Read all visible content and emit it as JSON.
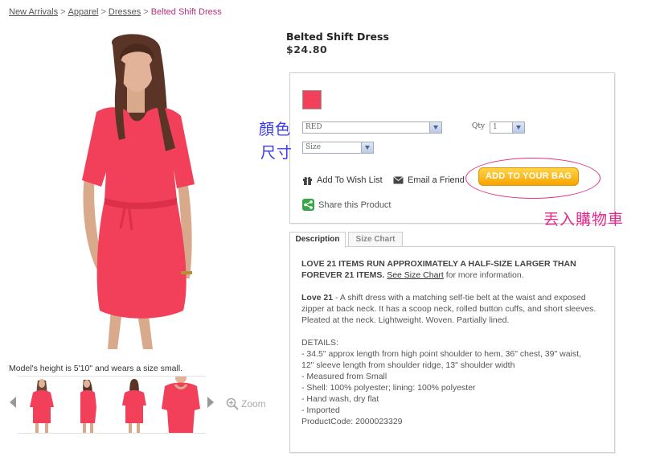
{
  "breadcrumb": {
    "items": [
      "New Arrivals",
      "Apparel",
      "Dresses"
    ],
    "separator": ">",
    "current": "Belted Shift Dress"
  },
  "product": {
    "title": "Belted Shift Dress",
    "price": "$24.80",
    "model_note": "Model's height is 5'10\" and wears a size small.",
    "dress_color": "#f2405a",
    "main_image_icon": "model-photo"
  },
  "gallery": {
    "thumbnail_count": 4,
    "zoom_label": "Zoom",
    "prev_icon": "arrow-left-icon",
    "next_icon": "arrow-right-icon"
  },
  "options": {
    "swatch_color": "#f2405a",
    "color_value": "RED",
    "size_placeholder": "Size",
    "qty_label": "Qty",
    "qty_value": "1"
  },
  "actions": {
    "wishlist": "Add To Wish List",
    "email_friend": "Email a Friend",
    "add_to_bag": "ADD TO YOUR BAG",
    "share": "Share this Product"
  },
  "annotations": {
    "color": "顏色",
    "size": "尺寸",
    "cart": "丟入購物車"
  },
  "tabs": [
    {
      "label": "Description",
      "active": true
    },
    {
      "label": "Size Chart",
      "active": false
    }
  ],
  "description": {
    "warning_bold": "LOVE 21 ITEMS RUN APPROXIMATELY A HALF-SIZE LARGER THAN FOREVER 21 ITEMS.",
    "size_chart_link": "See Size Chart",
    "warning_tail": "for more information.",
    "body_bold": "Love 21",
    "body_text": " - A shift dress with a matching self-tie belt at the waist and exposed zipper at back neck. It has a scoop neck, rolled button cuffs, and short sleeves. Pleated at the neck. Lightweight. Woven. Partially lined.",
    "details_heading": "DETAILS:",
    "details": [
      "- 34.5\" approx length from high point shoulder to hem, 36\" chest, 39\" waist,",
      "12\" sleeve length from shoulder ridge, 13\" shoulder width",
      "- Measured from Small",
      "- Shell: 100% polyester; lining: 100% polyester",
      "- Hand wash, dry flat",
      "- Imported",
      "ProductCode: 2000023329"
    ]
  }
}
